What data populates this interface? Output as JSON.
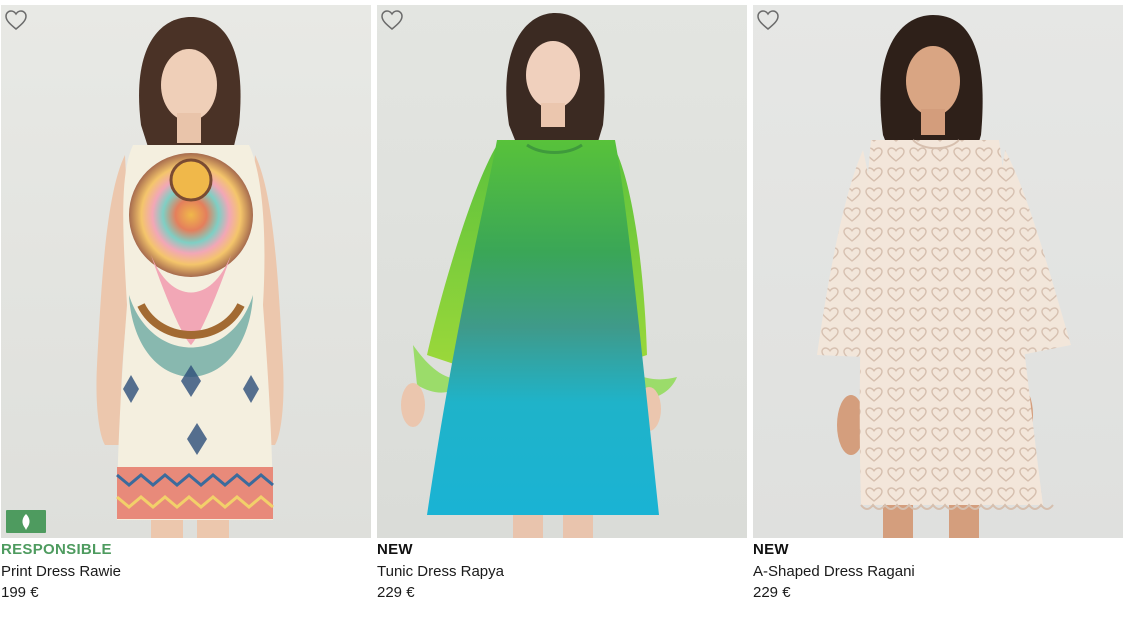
{
  "colors": {
    "responsible_tag": "#4e9b5f",
    "text": "#1a1a1a",
    "photo_bg_1": "#e6e7e3",
    "photo_bg_2": "#dfe1dd",
    "photo_bg_3": "#e4e5e3"
  },
  "icons": {
    "wishlist": "heart-outline-icon",
    "responsible_badge": "leaf-icon"
  },
  "products": [
    {
      "tag": "RESPONSIBLE",
      "name": "Print Dress Rawie",
      "price": "199 €",
      "image_alt": "Model wearing a sleeveless multicolour printed shift dress"
    },
    {
      "tag": "NEW",
      "name": "Tunic Dress Rapya",
      "price": "229 €",
      "image_alt": "Model wearing a green to turquoise ombré dress with feather cuffs"
    },
    {
      "tag": "NEW",
      "name": "A-Shaped Dress Ragani",
      "price": "229 €",
      "image_alt": "Model wearing a cream heart-lace A-line dress with wide sleeves"
    }
  ]
}
